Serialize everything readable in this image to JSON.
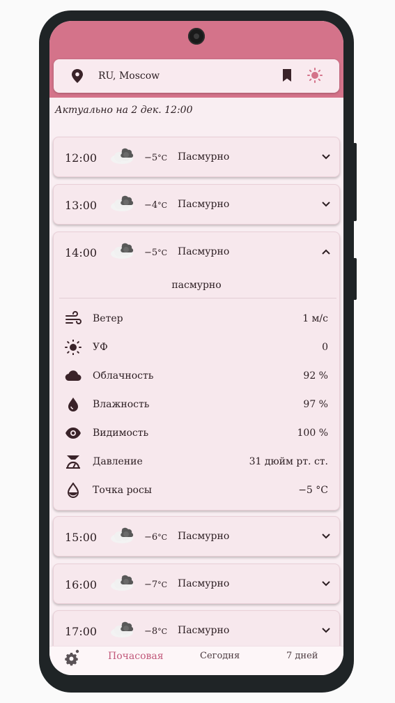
{
  "header": {
    "location": "RU, Moscow",
    "icons": {
      "location": "location-pin-icon",
      "bookmark": "bookmark-icon",
      "theme": "sun-icon"
    }
  },
  "updated_label": "Актуально на 2 дек. 12:00",
  "colors": {
    "accent": "#d4738a",
    "background": "#f9eef2",
    "card": "#f7e8ed",
    "active_tab": "#c1587a"
  },
  "hours": [
    {
      "time": "12:00",
      "temp": "−5",
      "unit": "°C",
      "condition": "Пасмурно",
      "expanded": false
    },
    {
      "time": "13:00",
      "temp": "−4",
      "unit": "°C",
      "condition": "Пасмурно",
      "expanded": false
    },
    {
      "time": "14:00",
      "temp": "−5",
      "unit": "°C",
      "condition": "Пасмурно",
      "expanded": true
    },
    {
      "time": "15:00",
      "temp": "−6",
      "unit": "°C",
      "condition": "Пасмурно",
      "expanded": false
    },
    {
      "time": "16:00",
      "temp": "−7",
      "unit": "°C",
      "condition": "Пасмурно",
      "expanded": false
    },
    {
      "time": "17:00",
      "temp": "−8",
      "unit": "°C",
      "condition": "Пасмурно",
      "expanded": false
    }
  ],
  "expanded_details": {
    "description": "пасмурно",
    "rows": [
      {
        "icon": "wind-icon",
        "label": "Ветер",
        "value": "1 м/с"
      },
      {
        "icon": "uv-sun-icon",
        "label": "УФ",
        "value": "0"
      },
      {
        "icon": "cloud-icon",
        "label": "Облачность",
        "value": "92 %"
      },
      {
        "icon": "humidity-drop-icon",
        "label": "Влажность",
        "value": "97 %"
      },
      {
        "icon": "eye-icon",
        "label": "Видимость",
        "value": "100 %"
      },
      {
        "icon": "pressure-gauge-icon",
        "label": "Давление",
        "value": "31 дюйм рт. ст."
      },
      {
        "icon": "dew-point-icon",
        "label": "Точка росы",
        "value": "−5 °C"
      }
    ]
  },
  "nav": {
    "settings_icon": "settings-gear-icon",
    "tabs": [
      {
        "label": "Почасовая",
        "active": true
      },
      {
        "label": "Сегодня",
        "active": false
      },
      {
        "label": "7 дней",
        "active": false
      }
    ]
  }
}
